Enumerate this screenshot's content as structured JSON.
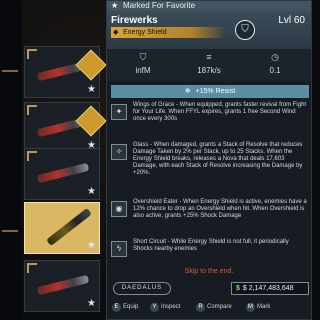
{
  "banner": {
    "label": "Marked For Favorite"
  },
  "item": {
    "name": "Firewerks",
    "level": "Lvl 60",
    "type": "Energy Shield",
    "type_icon": "shield-icon",
    "manufacturer_icon": "shield-badge-icon"
  },
  "stats": [
    {
      "icon": "shield-capacity-icon",
      "value": "infM"
    },
    {
      "icon": "recharge-rate-icon",
      "value": "187k/s"
    },
    {
      "icon": "recharge-delay-icon",
      "value": "0.1"
    }
  ],
  "resist": {
    "label": "+15% Resist",
    "icon": "snowflake-icon"
  },
  "perks": [
    {
      "icon": "wings-icon",
      "text": "Wings of Grace - When equipped, grants faster revival from Fight for Your Life. When FFYL expires, grants 1 free Second Wind once every 300s"
    },
    {
      "icon": "glass-icon",
      "text": "Glass - When damaged, grants a Stack of Resolve that reduces Damage Taken by 2% per Stack, up to 25 Stacks. When the Energy Shield breaks, releases a Nova that deals 17,603 Damage, with each Stack of Resolve increasing the Damage by +20%."
    },
    {
      "icon": "overshield-icon",
      "text": "Overshield Eater - When Energy Shield is active, enemies have a 12% chance to drop an Overshield when hit. When Overshield is also active, grants +25% Shock Damage"
    },
    {
      "icon": "lightning-icon",
      "text": "Short Circuit - While Energy Shield is not full, it periodically Shocks nearby enemies"
    }
  ],
  "skip": "Skip to the end.",
  "brand": "DAEDALUS",
  "money": {
    "icon": "dollar-icon",
    "value": "$ 2,147,483,648"
  },
  "footer": {
    "actions": [
      {
        "key": "E",
        "label": "Equip"
      },
      {
        "key": "Y",
        "label": "Inspect"
      },
      {
        "key": "R",
        "label": "Compare"
      },
      {
        "key": "M",
        "label": "Mark"
      }
    ]
  },
  "colors": {
    "accent": "#d9a63a",
    "resist": "#5a8ea2",
    "selected_tile": "#d9b763",
    "warning": "#e0553f"
  }
}
